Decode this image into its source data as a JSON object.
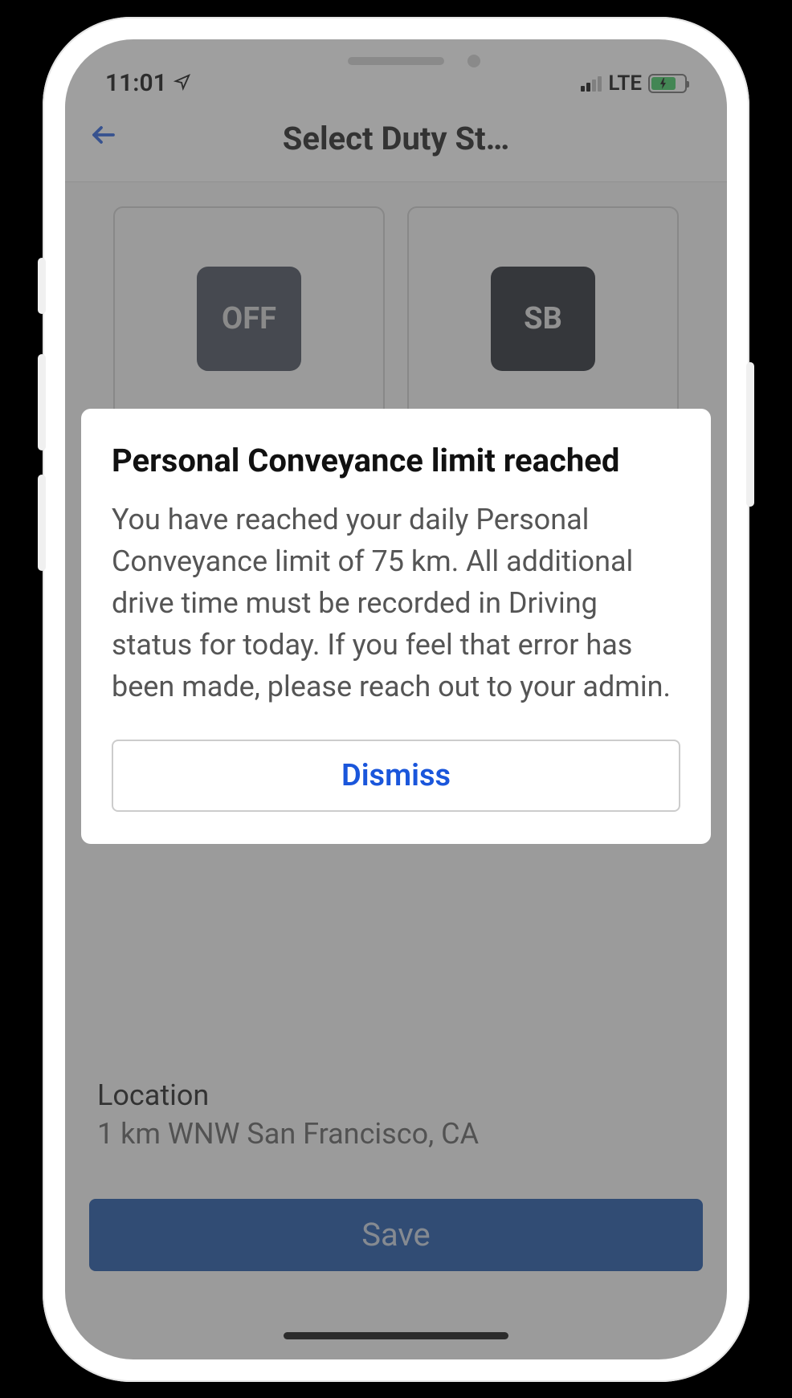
{
  "statusBar": {
    "time": "11:01",
    "network": "LTE"
  },
  "header": {
    "title": "Select Duty St…"
  },
  "tiles": {
    "off": "OFF",
    "sb": "SB"
  },
  "location": {
    "label": "Location",
    "value": "1 km WNW San Francisco, CA"
  },
  "footer": {
    "save": "Save"
  },
  "modal": {
    "title": "Personal Conveyance limit reached",
    "body": "You have reached your daily Personal Conveyance limit of 75 km. All additional drive time must be recorded in Driving status for today. If you feel that error has been made, please reach out to your admin.",
    "dismiss": "Dismiss"
  }
}
